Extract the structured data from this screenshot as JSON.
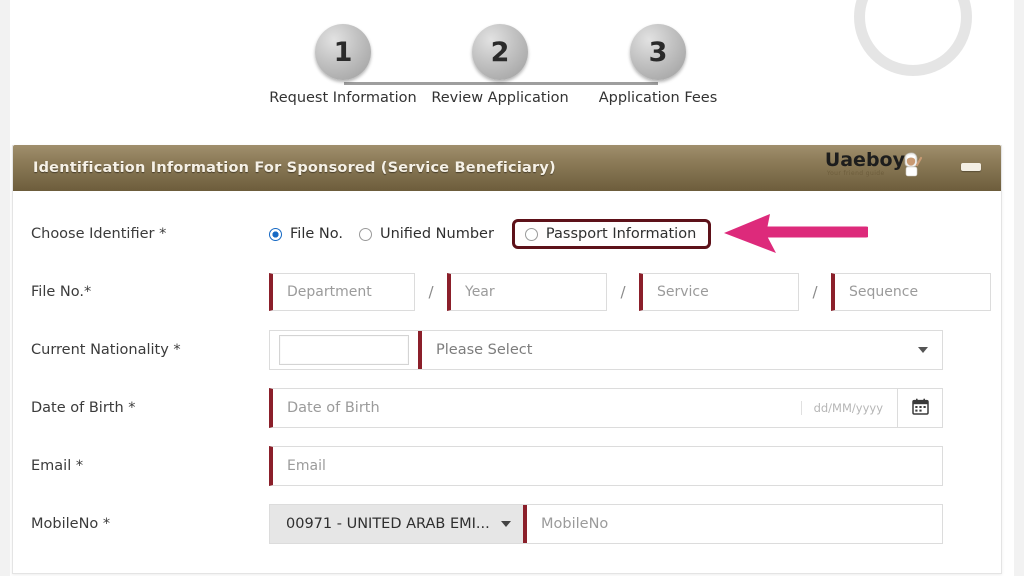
{
  "stepper": {
    "steps": [
      {
        "number": "1",
        "label": "Request Information"
      },
      {
        "number": "2",
        "label": "Review Application"
      },
      {
        "number": "3",
        "label": "Application Fees"
      }
    ]
  },
  "panel": {
    "title": "Identification Information For Sponsored (Service Beneficiary)",
    "brand": {
      "name": "Uaeboy",
      "tagline": "Your friend guide"
    },
    "minimize_label": "–"
  },
  "form": {
    "choose_identifier": {
      "label": "Choose Identifier *",
      "options": [
        {
          "label": "File No.",
          "selected": true
        },
        {
          "label": "Unified Number",
          "selected": false
        },
        {
          "label": "Passport Information",
          "selected": false,
          "highlighted": true
        }
      ]
    },
    "file_no": {
      "label": "File No.*",
      "separator": "/",
      "segments": [
        {
          "placeholder": "Department"
        },
        {
          "placeholder": "Year"
        },
        {
          "placeholder": "Service"
        },
        {
          "placeholder": "Sequence"
        }
      ]
    },
    "current_nationality": {
      "label": "Current Nationality *",
      "select_value": "Please Select"
    },
    "date_of_birth": {
      "label": "Date of Birth *",
      "placeholder": "Date of Birth",
      "format_hint": "dd/MM/yyyy",
      "calendar_icon": "calendar-icon"
    },
    "email": {
      "label": "Email *",
      "placeholder": "Email"
    },
    "mobile_no": {
      "label": "MobileNo *",
      "country_code": "00971 - UNITED ARAB EMI...",
      "placeholder": "MobileNo"
    }
  },
  "annotations": {
    "arrow_color": "#dd2a7b",
    "box_color": "#5d1018",
    "arrow_name": "pointing-left-arrow"
  },
  "colors": {
    "header_gradient_top": "#a08f6d",
    "header_gradient_bottom": "#6d5d3c",
    "required_bar": "#8b1f2a",
    "radio_selected": "#1669c4"
  }
}
